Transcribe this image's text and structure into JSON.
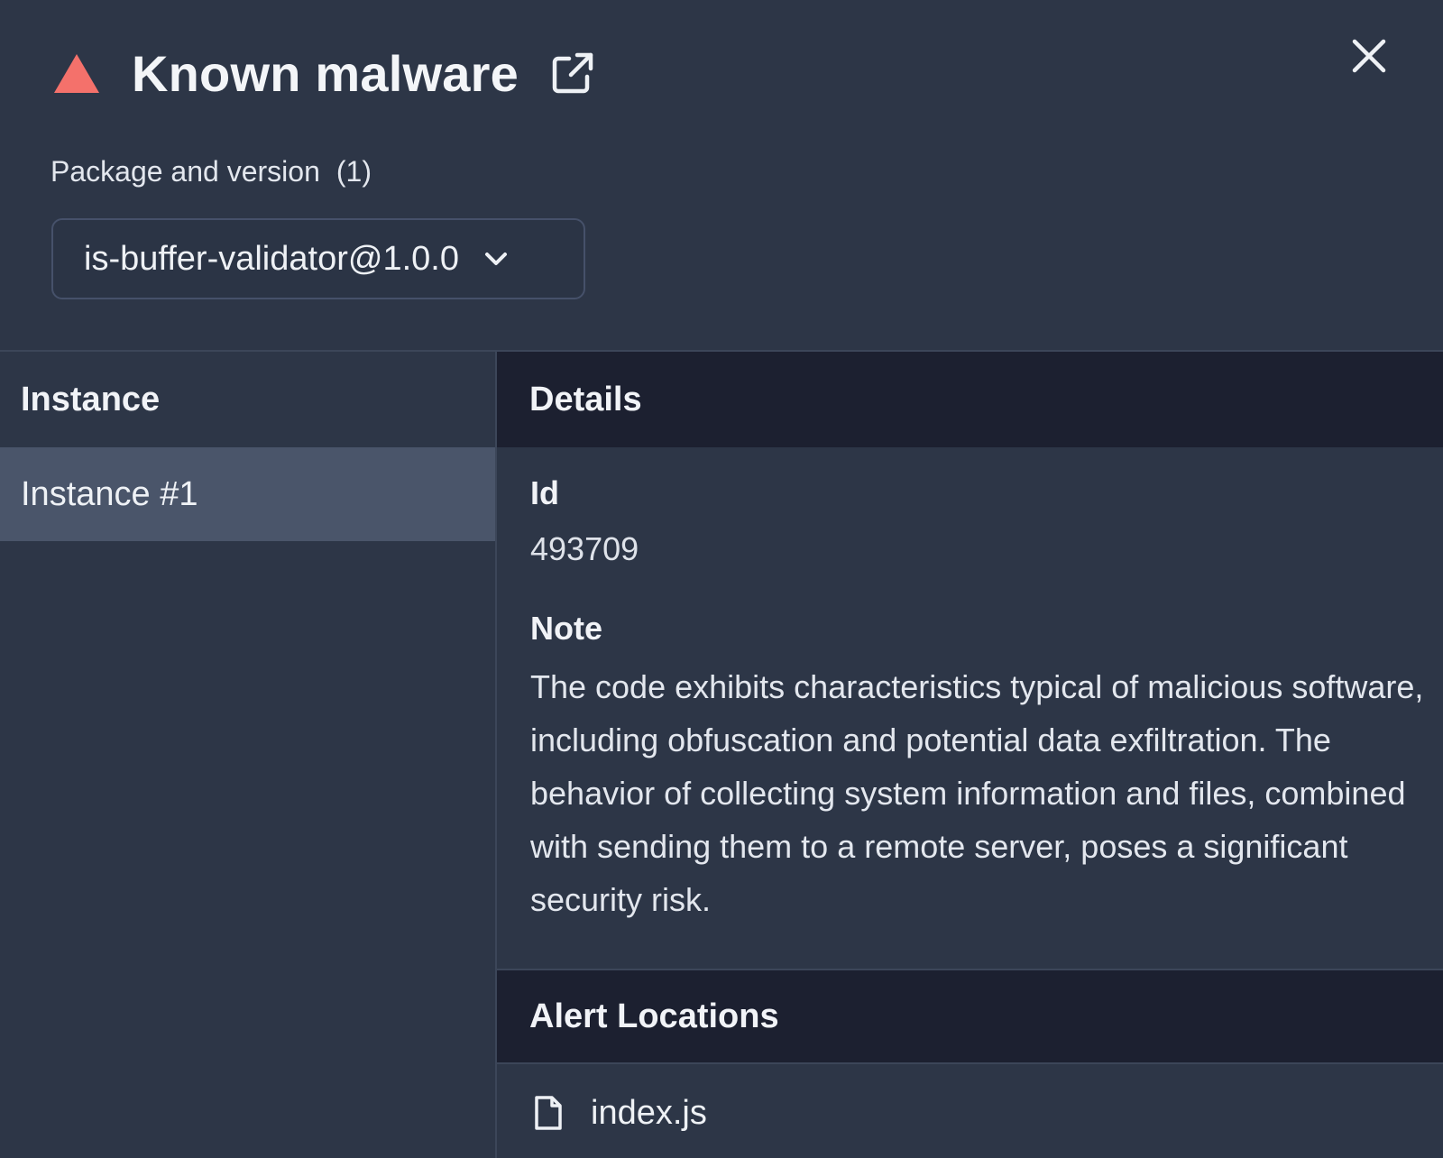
{
  "header": {
    "title": "Known malware",
    "close_label": "Close"
  },
  "package": {
    "label": "Package and version",
    "count": "(1)",
    "selected": "is-buffer-validator@1.0.0"
  },
  "instances": {
    "header": "Instance",
    "items": [
      {
        "label": "Instance #1"
      }
    ]
  },
  "details": {
    "header": "Details",
    "id_label": "Id",
    "id_value": "493709",
    "note_label": "Note",
    "note_text": "The code exhibits characteristics typical of malicious software, including obfuscation and potential data exfiltration. The behavior of collecting system information and files, combined with sending them to a remote server, poses a significant security risk."
  },
  "alert_locations": {
    "header": "Alert Locations",
    "files": [
      {
        "name": "index.js"
      }
    ]
  },
  "colors": {
    "warning": "#f4716b",
    "panel_bg": "#2d3647",
    "header_bg": "#1c2030",
    "selected_row_bg": "#4a556a"
  },
  "icons": {
    "warning": "warning-triangle-icon",
    "external_link": "external-link-icon",
    "close": "close-icon",
    "chevron": "chevron-down-icon",
    "file": "file-icon"
  }
}
